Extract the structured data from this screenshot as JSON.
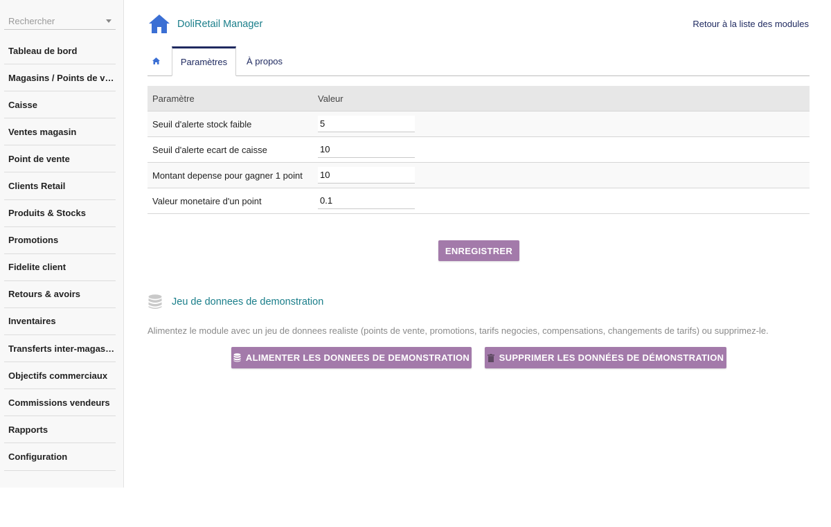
{
  "sidebar": {
    "search_placeholder": "Rechercher",
    "items": [
      {
        "label": "Tableau de bord"
      },
      {
        "label": "Magasins / Points de vente"
      },
      {
        "label": "Caisse"
      },
      {
        "label": "Ventes magasin"
      },
      {
        "label": "Point de vente"
      },
      {
        "label": "Clients Retail"
      },
      {
        "label": "Produits & Stocks"
      },
      {
        "label": "Promotions"
      },
      {
        "label": "Fidelite client"
      },
      {
        "label": "Retours & avoirs"
      },
      {
        "label": "Inventaires"
      },
      {
        "label": "Transferts inter-magasins"
      },
      {
        "label": "Objectifs commerciaux"
      },
      {
        "label": "Commissions vendeurs"
      },
      {
        "label": "Rapports"
      },
      {
        "label": "Configuration"
      }
    ]
  },
  "header": {
    "title": "DoliRetail Manager",
    "back_link": "Retour à la liste des modules",
    "logo_icon": "home-icon"
  },
  "tabs": {
    "home_icon": "home-icon",
    "params": "Paramètres",
    "about": "À propos",
    "active": "Paramètres"
  },
  "table": {
    "headers": {
      "param": "Paramètre",
      "value": "Valeur"
    },
    "rows": [
      {
        "label": "Seuil d'alerte stock faible",
        "value": "5"
      },
      {
        "label": "Seuil d'alerte ecart de caisse",
        "value": "10"
      },
      {
        "label": "Montant depense pour gagner 1 point",
        "value": "10"
      },
      {
        "label": "Valeur monetaire d'un point",
        "value": "0.1"
      }
    ]
  },
  "save_button": "ENREGISTRER",
  "demo": {
    "icon": "database-icon",
    "title": "Jeu de donnees de demonstration",
    "description": "Alimentez le module avec un jeu de donnees realiste (points de vente, promotions, tarifs negocies, compensations, changements de tarifs) ou supprimez-le.",
    "feed_button": "ALIMENTER LES DONNEES DE DEMONSTRATION",
    "delete_button": "SUPPRIMER LES DONNÉES DE DÉMONSTRATION"
  },
  "colors": {
    "accent_teal": "#1a7e8a",
    "button_purple": "#a37aaa",
    "link_navy": "#1f2a60",
    "home_blue": "#3b6fd4"
  }
}
